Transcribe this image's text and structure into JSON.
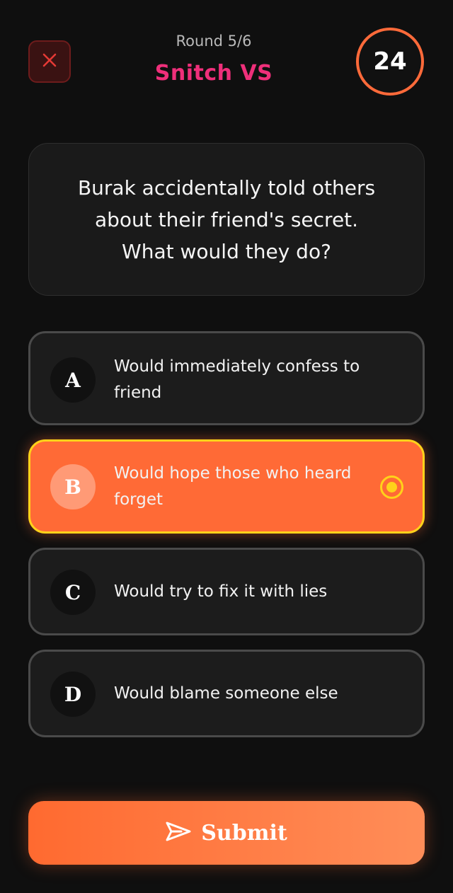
{
  "header": {
    "round_label": "Round 5/6",
    "title": "Snitch VS",
    "timer": "24",
    "close_icon": "close-icon"
  },
  "question": {
    "text": "Burak accidentally told others\nabout their friend's secret.\nWhat would they do?"
  },
  "options": [
    {
      "letter": "A",
      "text": "Would immediately confess to\nfriend",
      "selected": false
    },
    {
      "letter": "B",
      "text": "Would hope those who heard\nforget",
      "selected": true
    },
    {
      "letter": "C",
      "text": "Would try to fix it with lies",
      "selected": false
    },
    {
      "letter": "D",
      "text": "Would blame someone else",
      "selected": false
    }
  ],
  "submit": {
    "label": "Submit",
    "icon": "send-icon"
  },
  "colors": {
    "background": "#0f0f0f",
    "accent": "#ff6a36",
    "title_pink": "#ee2f7a",
    "selected_border": "#ffd21a",
    "close_red": "#e53935"
  }
}
